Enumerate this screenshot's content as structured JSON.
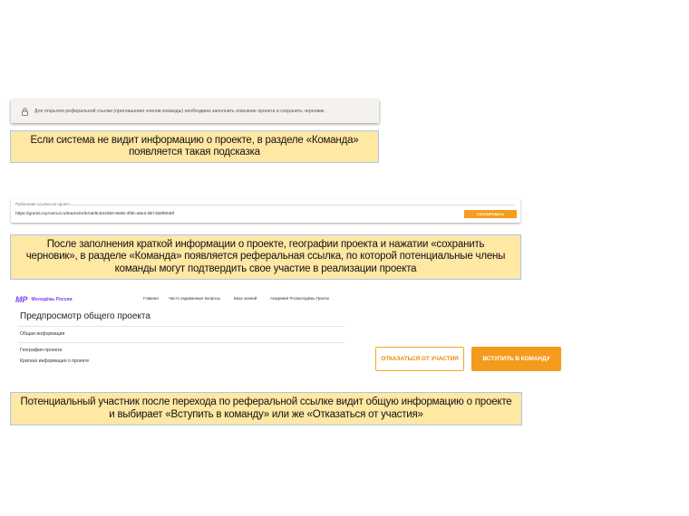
{
  "hint": {
    "text": "Для открытия реферальной ссылки (приглашения членов команды) необходимо заполнить описание проекта и сохранить черновик."
  },
  "callouts": {
    "c1": [
      "Если система не видит информацию о проекте, в разделе «Команда»",
      "появляется такая подсказка"
    ],
    "c2": [
      "После заполнения краткой информации о проекте, географии проекта и нажатии «сохранить",
      "черновик», в разделе «Команда» появляется реферальная ссылка, по которой потенциальные члены",
      "команды могут подтвердить свое участие в реализации проекта"
    ],
    "c3": [
      "Потенциальный участник после перехода по реферальной ссылке видит общую информацию о проекте",
      "и выбирает «Вступить в команду» или же «Отказаться от участия»"
    ]
  },
  "referral": {
    "label": "Рубличная ссылка на проект",
    "url": "https://grants.myrosmol.ru/teams/referral/8c6323b0-5665-4f0b-a9e2-9b71b8f8938f",
    "copy_label": "СКОПИРОВАТЬ"
  },
  "preview": {
    "logo_mark": "МР",
    "logo_text": "Молодёжь России",
    "menu": [
      "Главная",
      "Часто задаваемые вопросы",
      "База знаний",
      "Академия Росмолодёжь.Гранты"
    ],
    "title": "Предпросмотр общего проекта",
    "rows": [
      "Общая информация",
      "География проекта",
      "Краткая информация о проекте"
    ]
  },
  "buttons": {
    "decline": "ОТКАЗАТЬСЯ ОТ УЧАСТИЯ",
    "join": "ВСТУПИТЬ В КОМАНДУ"
  },
  "colors": {
    "accent": "#f59b1c",
    "brand": "#7a3ff2",
    "callout_bg": "#ffe7a4",
    "callout_border": "#a9c7ea"
  }
}
